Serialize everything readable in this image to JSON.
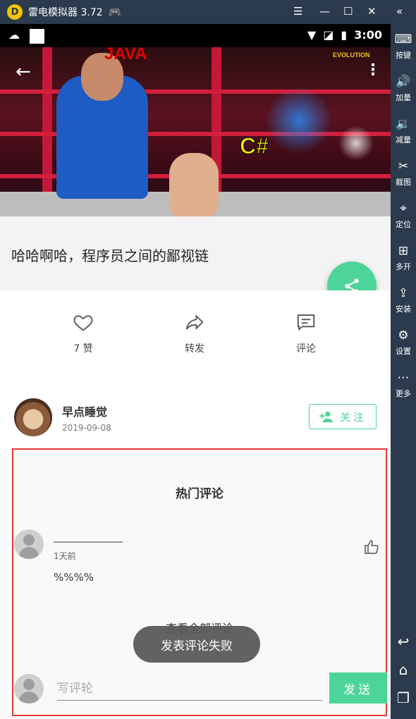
{
  "emulator": {
    "title": "雷电模拟器 3.72",
    "logo_letter": "D",
    "controls": [
      "menu-icon",
      "minimize-icon",
      "maximize-icon",
      "close-icon",
      "collapse-icon"
    ]
  },
  "status_bar": {
    "time": "3:00"
  },
  "video": {
    "overlay_text_java": "JAVA",
    "overlay_text_csharp": "C#",
    "overlay_text_brand": "EVOLUTION"
  },
  "post": {
    "title": "哈哈啊哈，程序员之间的鄙视链"
  },
  "actions": {
    "like_label": "7 赞",
    "share_label": "转发",
    "comment_label": "评论"
  },
  "author": {
    "name": "早点睡觉",
    "date": "2019-09-08",
    "follow_label": "关注"
  },
  "comments": {
    "section_title": "热门评论",
    "items": [
      {
        "user": "______________",
        "time": "1天前",
        "text": "%%%%"
      }
    ],
    "view_all_label": "查看全部评论",
    "input_placeholder": "写评轮",
    "send_label": "发送"
  },
  "toast": {
    "message": "发表评论失败"
  },
  "sidebar": {
    "items": [
      {
        "label": "按键",
        "icon": "keyboard-icon"
      },
      {
        "label": "加量",
        "icon": "volume-up-icon"
      },
      {
        "label": "减量",
        "icon": "volume-down-icon"
      },
      {
        "label": "截图",
        "icon": "scissors-icon"
      },
      {
        "label": "定位",
        "icon": "location-icon"
      },
      {
        "label": "多开",
        "icon": "multi-open-icon"
      },
      {
        "label": "安装",
        "icon": "apk-install-icon"
      },
      {
        "label": "设置",
        "icon": "gear-icon"
      },
      {
        "label": "更多",
        "icon": "more-dots-icon"
      }
    ]
  },
  "colors": {
    "accent": "#4dd498",
    "highlight_border": "#e53935",
    "emulator_chrome": "#2b3a4c"
  }
}
